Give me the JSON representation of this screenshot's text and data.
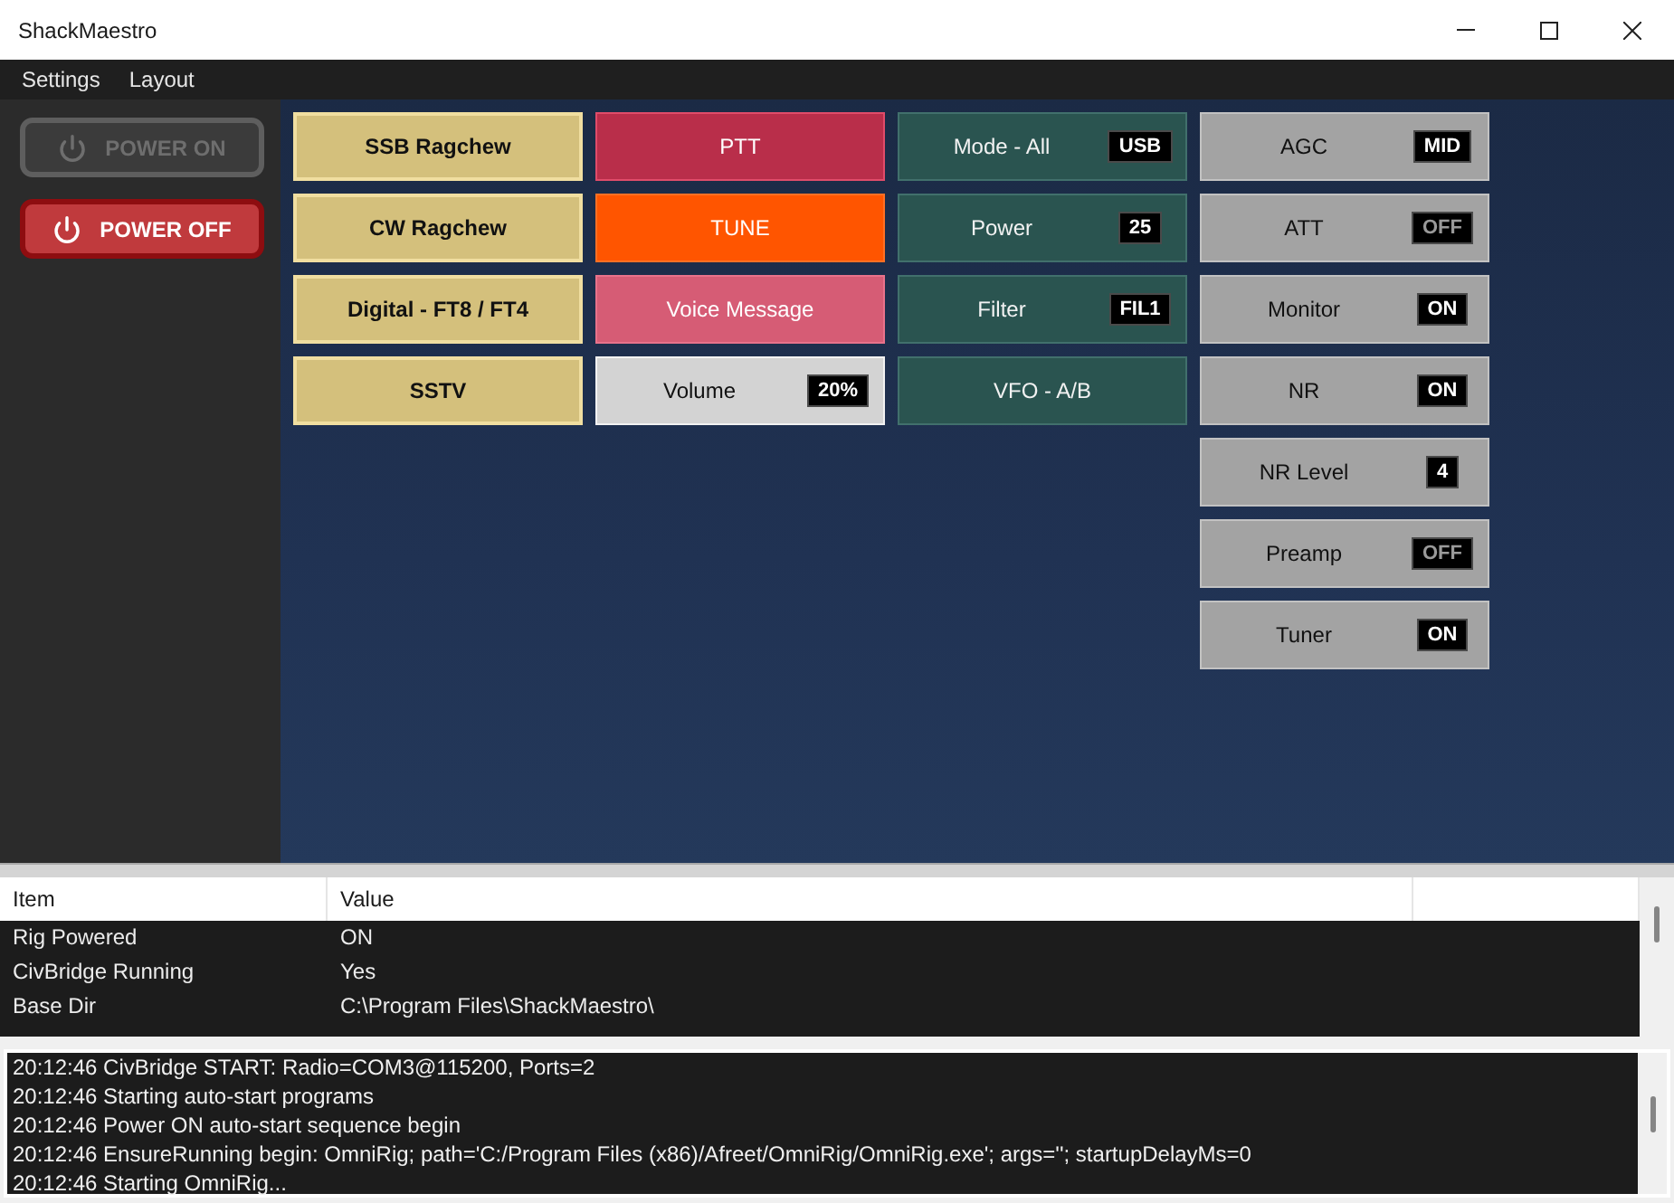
{
  "window": {
    "title": "ShackMaestro"
  },
  "menu": [
    {
      "label": "Settings"
    },
    {
      "label": "Layout"
    }
  ],
  "power_buttons": [
    {
      "kind": "on",
      "label": "POWER ON",
      "disabled": true
    },
    {
      "kind": "off",
      "label": "POWER OFF",
      "disabled": false
    }
  ],
  "button_columns": [
    {
      "buttons": [
        {
          "kind": "preset",
          "label": "SSB Ragchew"
        },
        {
          "kind": "preset",
          "label": "CW Ragchew"
        },
        {
          "kind": "preset",
          "label": "Digital - FT8 / FT4"
        },
        {
          "kind": "preset",
          "label": "SSTV"
        }
      ]
    },
    {
      "buttons": [
        {
          "kind": "ptt",
          "label": "PTT"
        },
        {
          "kind": "tune",
          "label": "TUNE"
        },
        {
          "kind": "voice",
          "label": "Voice Message"
        },
        {
          "kind": "volume",
          "label": "Volume",
          "value": "20%"
        }
      ]
    },
    {
      "buttons": [
        {
          "kind": "radio",
          "label": "Mode - All",
          "value": "USB"
        },
        {
          "kind": "radio",
          "label": "Power",
          "value": "25"
        },
        {
          "kind": "radio",
          "label": "Filter",
          "value": "FIL1"
        },
        {
          "kind": "radio",
          "label": "VFO - A/B"
        }
      ]
    },
    {
      "buttons": [
        {
          "kind": "toggle",
          "label": "AGC",
          "value": "MID"
        },
        {
          "kind": "toggle",
          "label": "ATT",
          "value": "OFF",
          "on": false
        },
        {
          "kind": "toggle",
          "label": "Monitor",
          "value": "ON",
          "on": true
        },
        {
          "kind": "toggle",
          "label": "NR",
          "value": "ON",
          "on": true
        },
        {
          "kind": "toggle",
          "label": "NR Level",
          "value": "4"
        },
        {
          "kind": "toggle",
          "label": "Preamp",
          "value": "OFF",
          "on": false
        },
        {
          "kind": "toggle",
          "label": "Tuner",
          "value": "ON",
          "on": true
        }
      ]
    }
  ],
  "status_table": {
    "columns": [
      "Item",
      "Value"
    ],
    "rows": [
      {
        "item": "Rig Powered",
        "value": "ON"
      },
      {
        "item": "CivBridge Running",
        "value": "Yes"
      },
      {
        "item": "Base Dir",
        "value": "C:\\Program Files\\ShackMaestro\\"
      }
    ]
  },
  "log": [
    "20:12:46 CivBridge START: Radio=COM3@115200, Ports=2",
    "20:12:46 Starting auto-start programs",
    "20:12:46 Power ON auto-start sequence begin",
    "20:12:46 EnsureRunning begin: OmniRig; path='C:/Program Files (x86)/Afreet/OmniRig/OmniRig.exe'; args=''; startupDelayMs=0",
    "20:12:46 Starting OmniRig..."
  ]
}
